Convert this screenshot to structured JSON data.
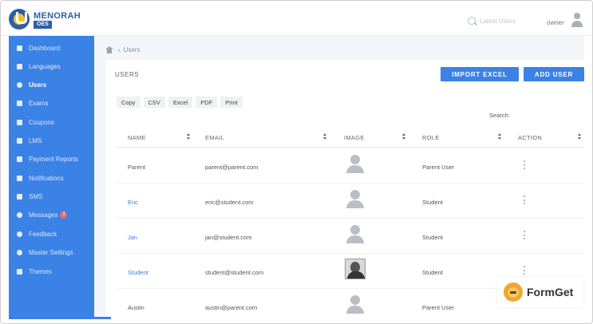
{
  "app": {
    "brand_name": "MENORAH",
    "brand_sub": "OES",
    "search_placeholder": "Latest Users",
    "user_name": "owner"
  },
  "sidebar": {
    "items": [
      {
        "label": "Dashboard",
        "icon": "dashboard-icon"
      },
      {
        "label": "Languages",
        "icon": "languages-icon"
      },
      {
        "label": "Users",
        "icon": "user-icon",
        "active": true
      },
      {
        "label": "Exams",
        "icon": "desktop-icon"
      },
      {
        "label": "Coupons",
        "icon": "tag-icon"
      },
      {
        "label": "LMS",
        "icon": "monitor-icon"
      },
      {
        "label": "Payment Reports",
        "icon": "credit-card-icon"
      },
      {
        "label": "Notifications",
        "icon": "bell-icon"
      },
      {
        "label": "SMS",
        "icon": "message-icon"
      },
      {
        "label": "Messages",
        "icon": "chat-icon",
        "badge": "3"
      },
      {
        "label": "Feedback",
        "icon": "comment-icon"
      },
      {
        "label": "Master Settings",
        "icon": "gear-icon"
      },
      {
        "label": "Themes",
        "icon": "grid-icon"
      }
    ]
  },
  "breadcrumb": {
    "separator": "›",
    "current": "Users"
  },
  "card": {
    "title": "USERS",
    "import_label": "IMPORT EXCEL",
    "add_label": "ADD USER"
  },
  "export_buttons": [
    "Copy",
    "CSV",
    "Excel",
    "PDF",
    "Print"
  ],
  "search_label": "Search:",
  "table": {
    "headers": [
      "NAME",
      "EMAIL",
      "IMAGE",
      "ROLE",
      "ACTION"
    ],
    "rows": [
      {
        "name": "Parent",
        "email": "parent@parent.com",
        "role": "Parent User",
        "image": "placeholder"
      },
      {
        "name": "Eric",
        "email": "eric@student.com",
        "role": "Student",
        "image": "placeholder"
      },
      {
        "name": "Jan",
        "email": "jan@student.com",
        "role": "Student",
        "image": "placeholder"
      },
      {
        "name": "Student",
        "email": "student@student.com",
        "role": "Student",
        "image": "photo"
      },
      {
        "name": "Austin",
        "email": "austin@parent.com",
        "role": "Parent User",
        "image": "placeholder"
      }
    ]
  },
  "watermark": {
    "text": "FormGet"
  },
  "colors": {
    "sidebar": "#3b82e6",
    "primary_button": "#3b82e6",
    "link": "#3b7bd6"
  }
}
